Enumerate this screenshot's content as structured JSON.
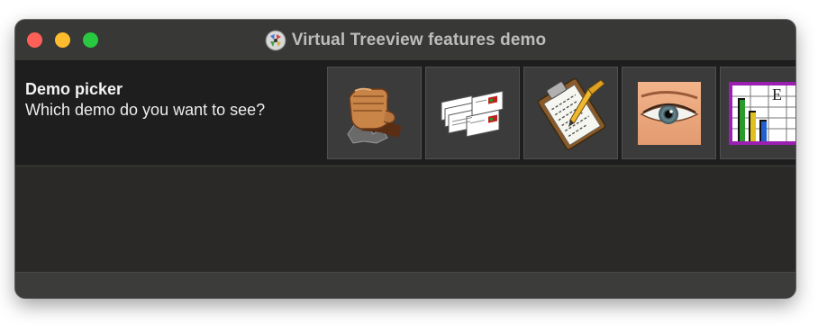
{
  "window": {
    "title": "Virtual Treeview features demo",
    "app_icon": "app-icon"
  },
  "traffic_lights": {
    "close_color": "#fe5f57",
    "minimize_color": "#febc2e",
    "maximize_color": "#28c840"
  },
  "demo_picker": {
    "title": "Demo picker",
    "subtitle": "Which demo do you want to see?"
  },
  "demos": [
    {
      "icon": "fist-icon"
    },
    {
      "icon": "documents-icon"
    },
    {
      "icon": "clipboard-icon"
    },
    {
      "icon": "eye-icon"
    },
    {
      "icon": "chart-icon"
    }
  ]
}
